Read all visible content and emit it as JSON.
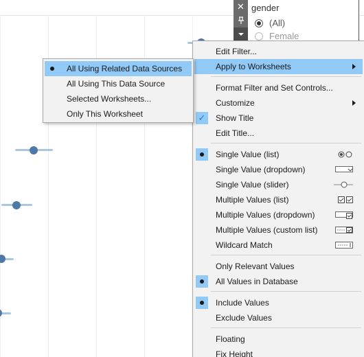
{
  "filter": {
    "title": "gender",
    "options": [
      {
        "label": "(All)",
        "selected": true
      },
      {
        "label": "Female",
        "selected": false
      }
    ],
    "toolbar_icons": [
      "close-icon",
      "pin-icon",
      "dropdown-arrow-icon"
    ]
  },
  "main_menu": {
    "edit_filter": "Edit Filter...",
    "apply_to_worksheets": "Apply to Worksheets",
    "format_filter": "Format Filter and Set Controls...",
    "customize": "Customize",
    "show_title": "Show Title",
    "edit_title": "Edit Title...",
    "single_value_list": "Single Value (list)",
    "single_value_dropdown": "Single Value (dropdown)",
    "single_value_slider": "Single Value (slider)",
    "multiple_values_list": "Multiple Values (list)",
    "multiple_values_dropdown": "Multiple Values (dropdown)",
    "multiple_values_custom_list": "Multiple Values (custom list)",
    "wildcard_match": "Wildcard Match",
    "only_relevant_values": "Only Relevant Values",
    "all_values_in_database": "All Values in Database",
    "include_values": "Include Values",
    "exclude_values": "Exclude Values",
    "floating": "Floating",
    "fix_height": "Fix Height"
  },
  "sub_menu": {
    "items": [
      "All Using Related Data Sources",
      "All Using This Data Source",
      "Selected Worksheets...",
      "Only This Worksheet"
    ],
    "selected_index": 0
  },
  "state": {
    "show_title": true,
    "single_value_list": true,
    "all_values_in_database": true,
    "include_values": true
  },
  "colors": {
    "highlight": "#91c9f7",
    "mark": "#4e79a7",
    "whisker": "#a9c7e0",
    "menu_bg": "#f2f2f2",
    "toolbar": "#6b6b6b"
  }
}
